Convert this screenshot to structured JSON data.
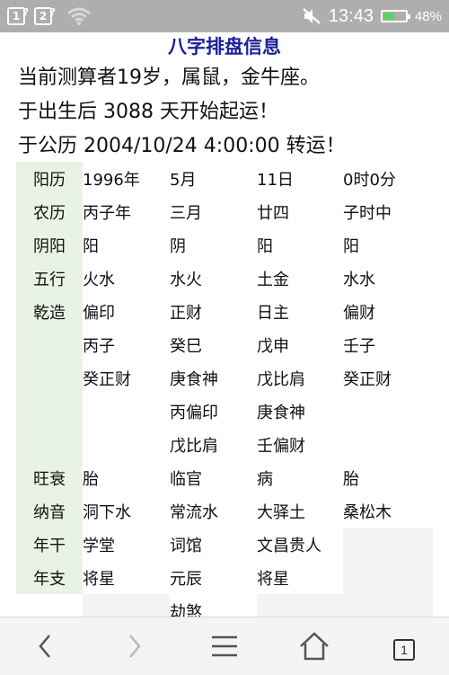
{
  "status_bar": {
    "notif1": "1",
    "notif2": "2",
    "time": "13:43",
    "battery": "48%",
    "battery_level": 0.48,
    "icons": [
      "notification-1-icon",
      "notification-2-icon",
      "wifi-icon",
      "mute-icon",
      "battery-icon"
    ]
  },
  "page": {
    "title": "八字排盘信息",
    "lines": [
      "当前测算者19岁，属鼠，金牛座。",
      "于出生后 3088 天开始起运！",
      "于公历 2004/10/24 4:00:00 转运！"
    ]
  },
  "table": {
    "rows": [
      {
        "label": "阳历",
        "cells": [
          "1996年",
          "5月",
          "11日",
          "0时0分"
        ]
      },
      {
        "label": "农历",
        "cells": [
          "丙子年",
          "三月",
          "廿四",
          "子时中"
        ]
      },
      {
        "label": "阴阳",
        "cells": [
          "阳",
          "阴",
          "阳",
          "阳"
        ]
      },
      {
        "label": "五行",
        "cells": [
          "火水",
          "水火",
          "土金",
          "水水"
        ]
      },
      {
        "label": "乾造",
        "cells": [
          "偏印",
          "正财",
          "日主",
          "偏财"
        ]
      },
      {
        "label": "",
        "cells": [
          "丙子",
          "癸巳",
          "戊申",
          "壬子"
        ]
      },
      {
        "label": "",
        "cells": [
          "癸正财",
          "庚食神",
          "戊比肩",
          "癸正财"
        ]
      },
      {
        "label": "",
        "cells": [
          "",
          "丙偏印",
          "庚食神",
          ""
        ]
      },
      {
        "label": "",
        "cells": [
          "",
          "戊比肩",
          "壬偏财",
          ""
        ]
      },
      {
        "label": "旺衰",
        "cells": [
          "胎",
          "临官",
          "病",
          "胎"
        ]
      },
      {
        "label": "纳音",
        "cells": [
          "洞下水",
          "常流水",
          "大驿土",
          "桑松木"
        ]
      },
      {
        "label": "年干",
        "cells": [
          "学堂",
          "词馆",
          "文昌贵人",
          ""
        ]
      },
      {
        "label": "年支",
        "cells": [
          "将星",
          "元辰",
          "将星",
          ""
        ]
      },
      {
        "label": "",
        "cells": [
          "",
          "劫煞",
          "",
          ""
        ]
      }
    ]
  },
  "nav": {
    "tab_count": "1",
    "icons": [
      "back-icon",
      "forward-icon",
      "menu-icon",
      "home-icon",
      "tabs-icon"
    ]
  },
  "colors": {
    "title": "#1b1f9a",
    "label_bg": "#e9f3e3",
    "cell_bg": "#f3f3f3",
    "status_bar": "#aeaeae"
  }
}
